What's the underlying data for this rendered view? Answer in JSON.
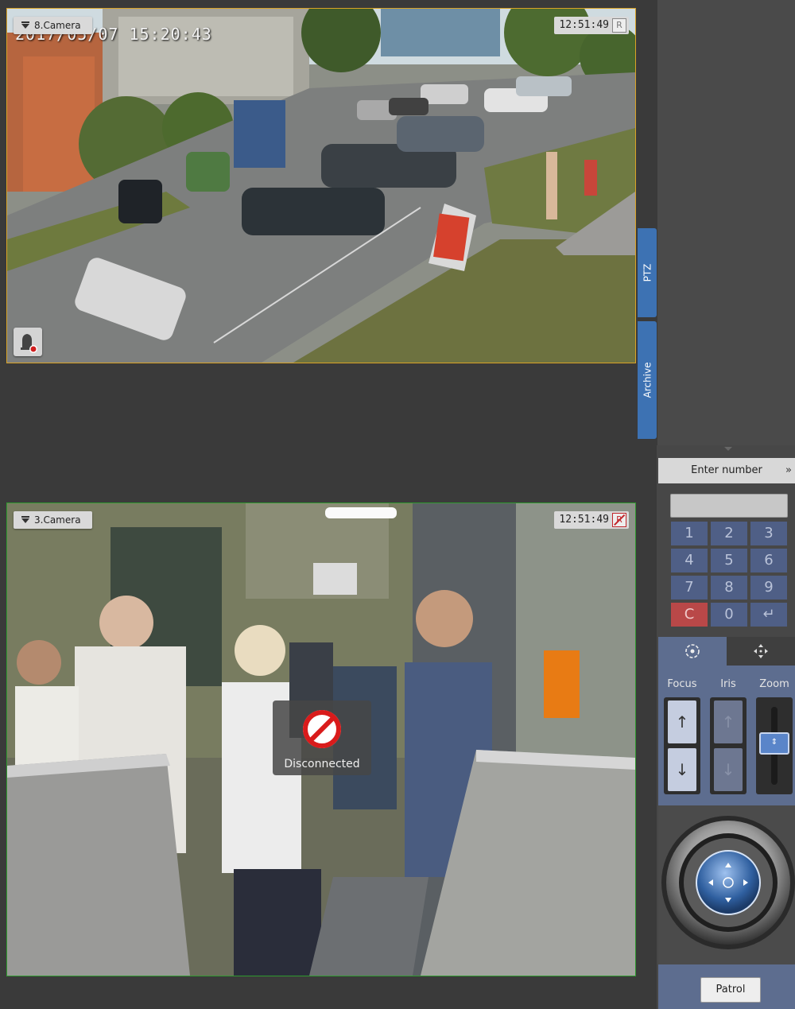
{
  "cameras": [
    {
      "title": "8.Camera",
      "time": "12:51:49",
      "rec_label": "R",
      "osd_text": "2017/05/07 15:20:43",
      "border_color": "#d9a326"
    },
    {
      "title": "3.Camera",
      "time": "12:51:49",
      "rec_label": "R",
      "status": "Disconnected",
      "border_color": "#2f9a2f"
    }
  ],
  "side_tabs": {
    "ptz": "PTZ",
    "archive": "Archive"
  },
  "ptz_panel": {
    "enter_number": "Enter number",
    "keypad": [
      "1",
      "2",
      "3",
      "4",
      "5",
      "6",
      "7",
      "8",
      "9",
      "C",
      "0",
      "↵"
    ],
    "focus_label": "Focus",
    "iris_label": "Iris",
    "zoom_label": "Zoom",
    "patrol_label": "Patrol"
  },
  "colors": {
    "accent": "#3d72b3",
    "keypad": "#4f5f86",
    "clear_key": "#b94848",
    "panel": "#5d6d8f"
  },
  "icons": [
    "alarm-bell-icon",
    "disconnected-icon",
    "preset-icon",
    "move-icon",
    "arrow-up-icon",
    "arrow-down-icon",
    "joystick-icon"
  ]
}
